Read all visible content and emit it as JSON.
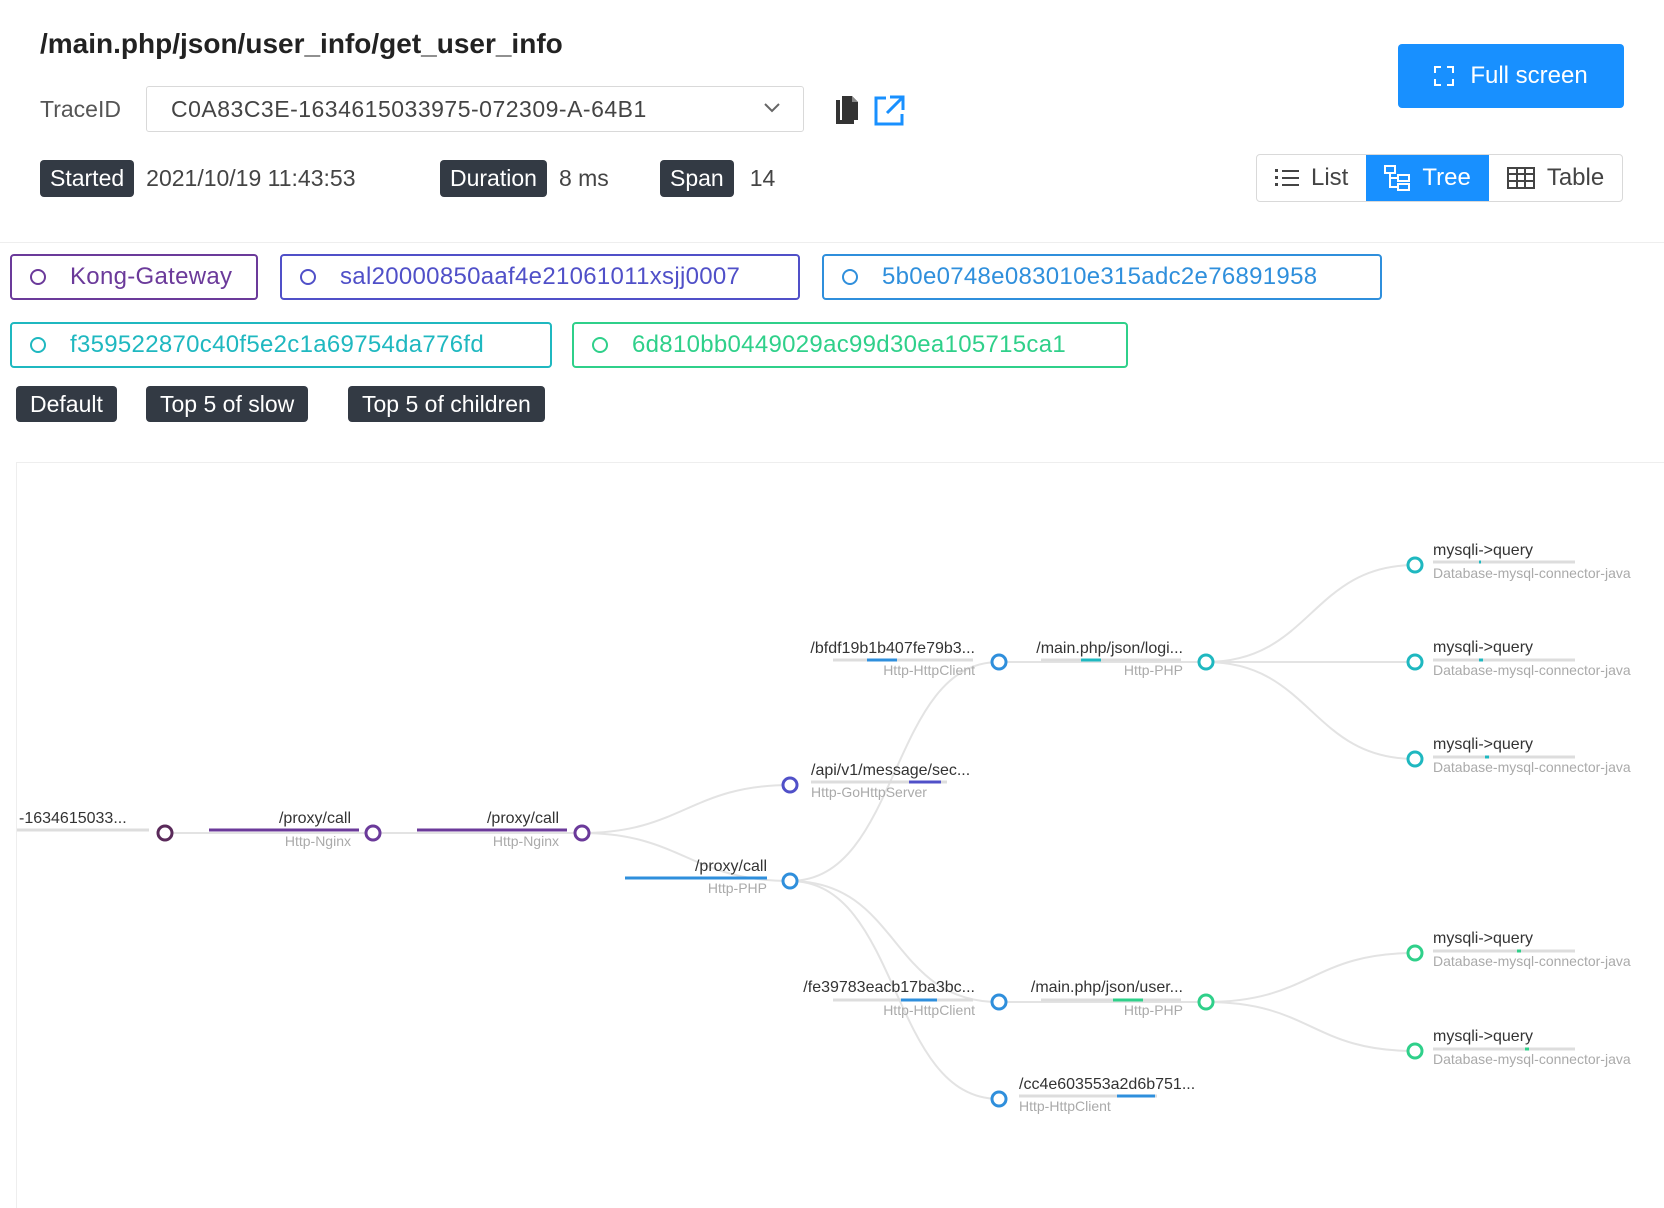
{
  "header": {
    "title": "/main.php/json/user_info/get_user_info",
    "trace_label": "TraceID",
    "trace_id": "C0A83C3E-1634615033975-072309-A-64B1",
    "fullscreen_label": "Full screen",
    "started_label": "Started",
    "started_value": "2021/10/19 11:43:53",
    "duration_label": "Duration",
    "duration_value": "8 ms",
    "span_label": "Span",
    "span_value": "14"
  },
  "view_modes": [
    {
      "label": "List",
      "icon": "list-icon",
      "active": false
    },
    {
      "label": "Tree",
      "icon": "tree-icon",
      "active": true
    },
    {
      "label": "Table",
      "icon": "table-icon",
      "active": false
    }
  ],
  "services": [
    {
      "name": "Kong-Gateway",
      "color": "#6b3a9a"
    },
    {
      "name": "sal20000850aaf4e21061011xsjj0007",
      "color": "#5050c8"
    },
    {
      "name": "5b0e0748e083010e315adc2e76891958",
      "color": "#2f8fdc"
    },
    {
      "name": "f359522870c40f5e2c1a69754da776fd",
      "color": "#1fb8c0"
    },
    {
      "name": "6d810bb0449029ac99d30ea105715ca1",
      "color": "#2fd08a"
    }
  ],
  "filters": [
    "Default",
    "Top 5 of slow",
    "Top 5 of children"
  ],
  "tree": {
    "nodes": [
      {
        "id": "n0",
        "title": "-1634615033...",
        "type": ""
      },
      {
        "id": "n1",
        "title": "/proxy/call",
        "type": "Http-Nginx"
      },
      {
        "id": "n2",
        "title": "/proxy/call",
        "type": "Http-Nginx"
      },
      {
        "id": "n3",
        "title": "/api/v1/message/sec...",
        "type": "Http-GoHttpServer"
      },
      {
        "id": "n4",
        "title": "/proxy/call",
        "type": "Http-PHP"
      },
      {
        "id": "n5",
        "title": "/bfdf19b1b407fe79b3...",
        "type": "Http-HttpClient"
      },
      {
        "id": "n6",
        "title": "/fe39783eacb17ba3bc...",
        "type": "Http-HttpClient"
      },
      {
        "id": "n7",
        "title": "/cc4e603553a2d6b751...",
        "type": "Http-HttpClient"
      },
      {
        "id": "n8",
        "title": "/main.php/json/logi...",
        "type": "Http-PHP"
      },
      {
        "id": "n9",
        "title": "/main.php/json/user...",
        "type": "Http-PHP"
      },
      {
        "id": "n10",
        "title": "mysqli->query",
        "type": "Database-mysql-connector-java"
      },
      {
        "id": "n11",
        "title": "mysqli->query",
        "type": "Database-mysql-connector-java"
      },
      {
        "id": "n12",
        "title": "mysqli->query",
        "type": "Database-mysql-connector-java"
      },
      {
        "id": "n13",
        "title": "mysqli->query",
        "type": "Database-mysql-connector-java"
      },
      {
        "id": "n14",
        "title": "mysqli->query",
        "type": "Database-mysql-connector-java"
      }
    ]
  },
  "colors": {
    "accent": "#1890ff",
    "tag_dark": "#333a44"
  }
}
